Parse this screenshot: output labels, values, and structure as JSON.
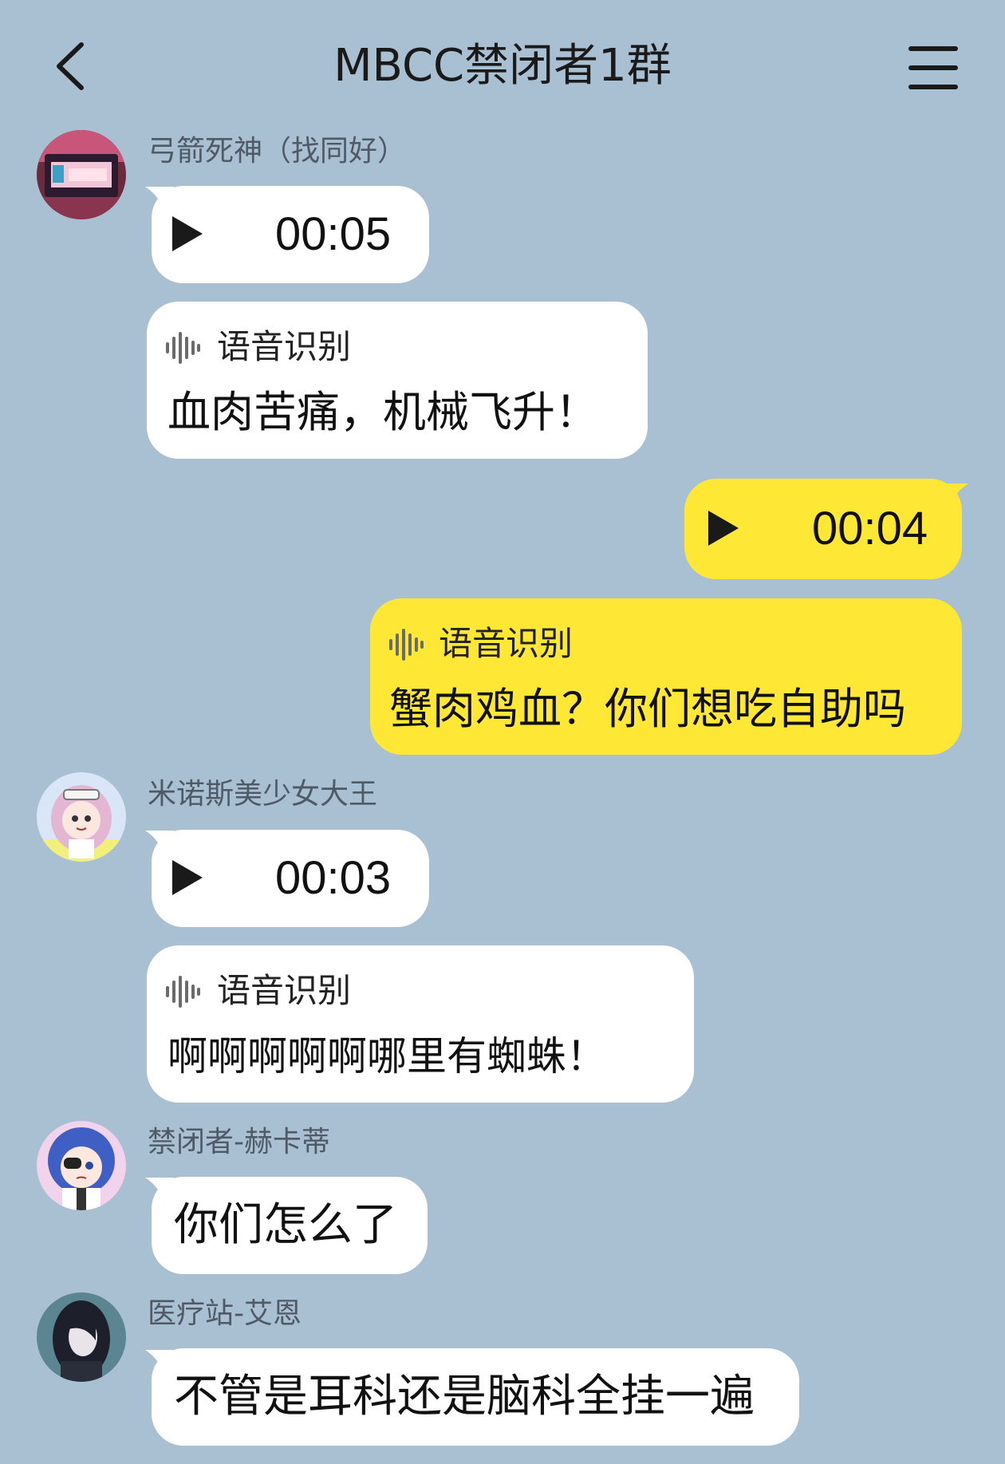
{
  "header": {
    "back_icon": "chevron-left-icon",
    "title": "MBCC禁闭者1群",
    "menu_icon": "hamburger-menu-icon"
  },
  "colors": {
    "background": "#a9bfd2",
    "bubble_incoming": "#ffffff",
    "bubble_outgoing": "#ffe835"
  },
  "messages": [
    {
      "sender": "弓箭死神（找同好）",
      "voice_duration": "00:05",
      "asr_label": "语音识别",
      "asr_text": "血肉苦痛，机械飞升！"
    },
    {
      "sender": "",
      "outgoing": true,
      "voice_duration": "00:04",
      "asr_label": "语音识别",
      "asr_text": "蟹肉鸡血？你们想吃自助吗"
    },
    {
      "sender": "米诺斯美少女大王",
      "voice_duration": "00:03",
      "asr_label": "语音识别",
      "asr_text": "啊啊啊啊啊哪里有蜘蛛！"
    },
    {
      "sender": "禁闭者-赫卡蒂",
      "text": "你们怎么了"
    },
    {
      "sender": "医疗站-艾恩",
      "text": "不管是耳科还是脑科全挂一遍"
    }
  ]
}
